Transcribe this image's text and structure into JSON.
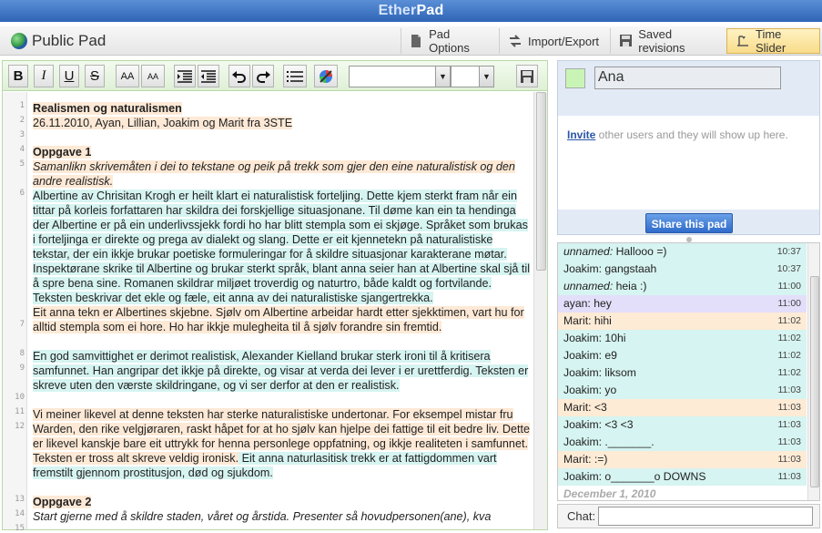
{
  "titlebar": {
    "ether": "Ether",
    "pad": "Pad"
  },
  "docbar": {
    "pad_title": "Public Pad",
    "pad_options": "Pad Options",
    "import_export": "Import/Export",
    "saved_revisions": "Saved revisions",
    "time_slider": "Time Slider"
  },
  "toolbar": {
    "bold": "B",
    "italic": "I",
    "underline": "U",
    "strike": "S",
    "font_size_up": "AA",
    "font_size_down": "AA"
  },
  "editor": {
    "line_numbers": [
      "1",
      "2",
      "3",
      "4",
      "5",
      "6",
      "7",
      "8",
      "9",
      "10",
      "11",
      "12",
      "13",
      "14",
      "15"
    ],
    "lines": {
      "l1": "Realismen og naturalismen",
      "l2": "26.11.2010, Ayan, Lillian, Joakim og Marit fra 3STE",
      "l4": "Oppgave 1",
      "l5": "Samanlikn skrivemåten i dei to tekstane og peik på trekk som gjer den eine naturalistisk og den andre realistisk.",
      "l6a": "Albertine av Chrisitan Krogh er heilt klart ei naturalistisk forteljing. Dette kjem sterkt fram når ein tittar på korleis forfattaren har skildra dei forskjellige situasjonane. Til døme kan ein ta hendinga der Albertine er på ein underlivssjekk fordi ho har blitt stempla som ei skjøge. Språket som brukas i forteljinga er direkte og prega av dialekt og slang. Dette er eit kjennetekn på naturalistiske tekstar, der ein ikkje brukar poetiske formuleringar for å skildre situasjonar karakterane møtar. Inspektørane skrike til Albertine og brukar sterkt språk, blant anna seier han at Albertine skal sjå til å spre bena sine. Romanen skildrar miljøet troverdig og naturtro, både kaldt og fortvilande. Teksten beskrivar det ekle og fæle, eit anna av dei naturalistiske sjangertrekka.",
      "l7": "Eit anna tekn er Albertines skjebne. Sjølv om Albertine arbeidar hardt etter sjekktimen, vart hu for alltid stempla som ei hore. Ho har ikkje mulegheita til å sjølv forandre sin fremtid.",
      "l9": "En god samvittighet er derimot realistisk, Alexander Kielland brukar sterk ironi til å kritisera samfunnet. Han angripar det ikkje på direkte, og visar at verda dei lever i er urettferdig. Teksten er skreve uten den værste skildringane, og vi ser derfor at den er realistisk.",
      "l11": " Vi meiner likevel at denne teksten har sterke naturalistiske undertonar. For eksempel mistar fru Warden, den rike velgjøraren, raskt håpet for at ho sjølv kan hjelpe dei fattige til eit bedre liv. Dette er likevel kanskje bare eit uttrykk for henna personlege oppfatning, og ikkje realiteten i samfunnet. Teksten er tross alt skreve veldig ironisk.",
      "l11b": "   Eit anna naturlasitisk trekk er at fattigdommen vart fremstilt gjennom prostitusjon, død og sjukdom.",
      "l14": "Oppgave 2",
      "l15": "Start gjerne med å skildre staden, våret og årstida. Presenter så hovudpersonen(ane), kva"
    }
  },
  "users": {
    "my_name": "Ana",
    "invite_link": "Invite",
    "invite_rest": " other users and they will show up here.",
    "share_button": "Share this pad",
    "my_color": "#c8f5b5"
  },
  "chat": {
    "messages": [
      {
        "author": "unnamed",
        "text": "Hallooo =)",
        "time": "10:37",
        "style": "anon"
      },
      {
        "author": "Joakim",
        "text": "gangstaah",
        "time": "10:37",
        "style": "joa"
      },
      {
        "author": "unnamed",
        "text": "heia :)",
        "time": "11:00",
        "style": "anon"
      },
      {
        "author": "ayan",
        "text": "hey",
        "time": "11:00",
        "style": "ayan"
      },
      {
        "author": "Marit",
        "text": "hihi",
        "time": "11:02",
        "style": "marit"
      },
      {
        "author": "Joakim",
        "text": "10hi",
        "time": "11:02",
        "style": "joa"
      },
      {
        "author": "Joakim",
        "text": "e9",
        "time": "11:02",
        "style": "joa"
      },
      {
        "author": "Joakim",
        "text": "liksom",
        "time": "11:02",
        "style": "joa"
      },
      {
        "author": "Joakim",
        "text": "yo",
        "time": "11:03",
        "style": "joa"
      },
      {
        "author": "Marit",
        "text": "<3",
        "time": "11:03",
        "style": "marit"
      },
      {
        "author": "Joakim",
        "text": "<3 <3",
        "time": "11:03",
        "style": "joa"
      },
      {
        "author": "Joakim",
        "text": "._______.",
        "time": "11:03",
        "style": "joa"
      },
      {
        "author": "Marit",
        "text": ":=)",
        "time": "11:03",
        "style": "marit"
      },
      {
        "author": "Joakim",
        "text": "o_______o DOWNS",
        "time": "11:03",
        "style": "joa"
      }
    ],
    "date_divider": "December 1, 2010",
    "input_label": "Chat:"
  },
  "colors": {
    "ana_highlight": "#fde9d6",
    "joakim_highlight": "#d6f4f1",
    "ayan_highlight": "#e3defa",
    "header_blue": "#3a70c2"
  }
}
